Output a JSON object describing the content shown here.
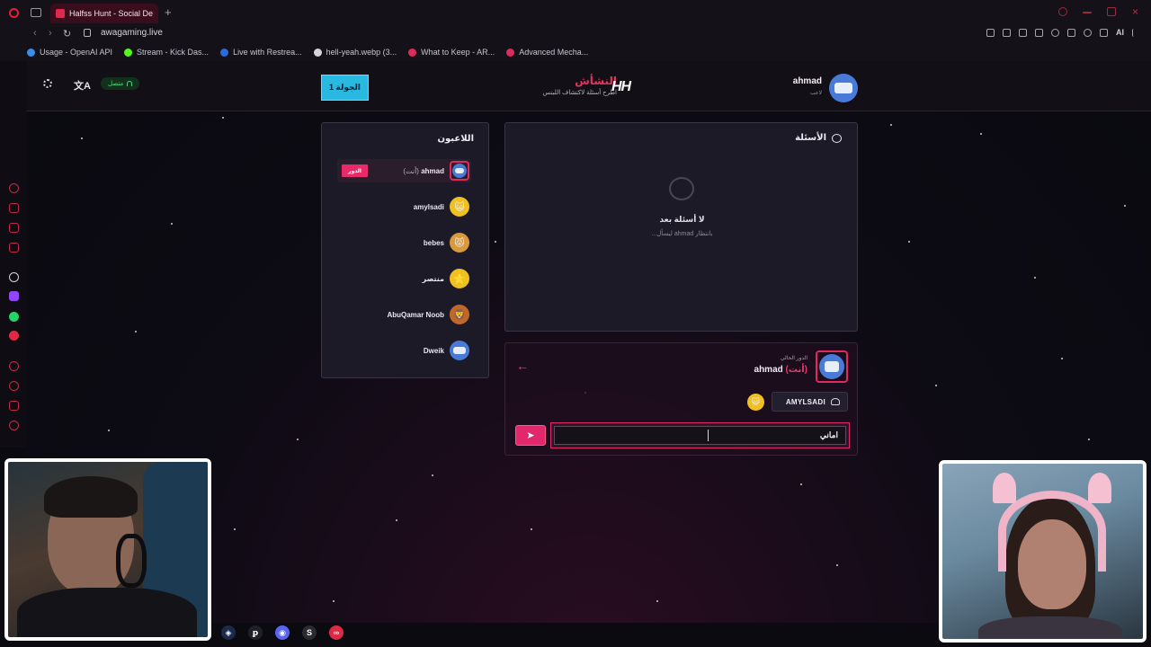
{
  "browser": {
    "tab_title": "Halfss Hunt - Social Deduct",
    "url": "awagaming.live",
    "bookmarks": [
      {
        "label": "Usage - OpenAI API",
        "color": "#3a8ee8"
      },
      {
        "label": "Stream - Kick Das...",
        "color": "#53fc18"
      },
      {
        "label": "Live with Restrea...",
        "color": "#2a6ae0"
      },
      {
        "label": "hell-yeah.webp (3...",
        "color": "#d8d4de"
      },
      {
        "label": "What to Keep - AR...",
        "color": "#e02a5e"
      },
      {
        "label": "Advanced Mecha...",
        "color": "#e02a5e"
      }
    ],
    "toolbar_ai": "AI"
  },
  "header": {
    "online_label": "متصل",
    "round_label": "الجولة 1",
    "brand_title": "النشأش",
    "brand_subtitle": "اطرح أسئلة لاكتشاف اللبنس",
    "brand_logo": "HH",
    "user_name": "ahmad",
    "user_role": "لاعب"
  },
  "players_panel": {
    "title": "اللاعبون",
    "turn_badge": "الدور",
    "players": [
      {
        "name": "ahmad",
        "you_suffix": "(أنت)",
        "avatar": "robot",
        "current": true
      },
      {
        "name": "amylsadi",
        "avatar": "😺",
        "current": false
      },
      {
        "name": "bebes",
        "avatar": "😾",
        "current": false
      },
      {
        "name": "منتصر",
        "avatar": "⭐",
        "current": false
      },
      {
        "name": "AbuQamar Noob",
        "avatar": "🦁",
        "current": false
      },
      {
        "name": "Dweik",
        "avatar": "robot",
        "current": false
      }
    ]
  },
  "questions_panel": {
    "title": "الأسئلة",
    "empty_title": "لا أسئلة بعد",
    "empty_subtitle": "...ليسأل ahmad بانتظار"
  },
  "turn_panel": {
    "current_turn_label": "الدور الحالي",
    "current_user": "ahmad",
    "you_suffix": "(أنت)",
    "target_name": "AMYLSADI",
    "target_avatar": "😺",
    "input_value": "اماني"
  },
  "dock": [
    "◈",
    "ꝑ",
    "◉",
    "S",
    "∞"
  ]
}
